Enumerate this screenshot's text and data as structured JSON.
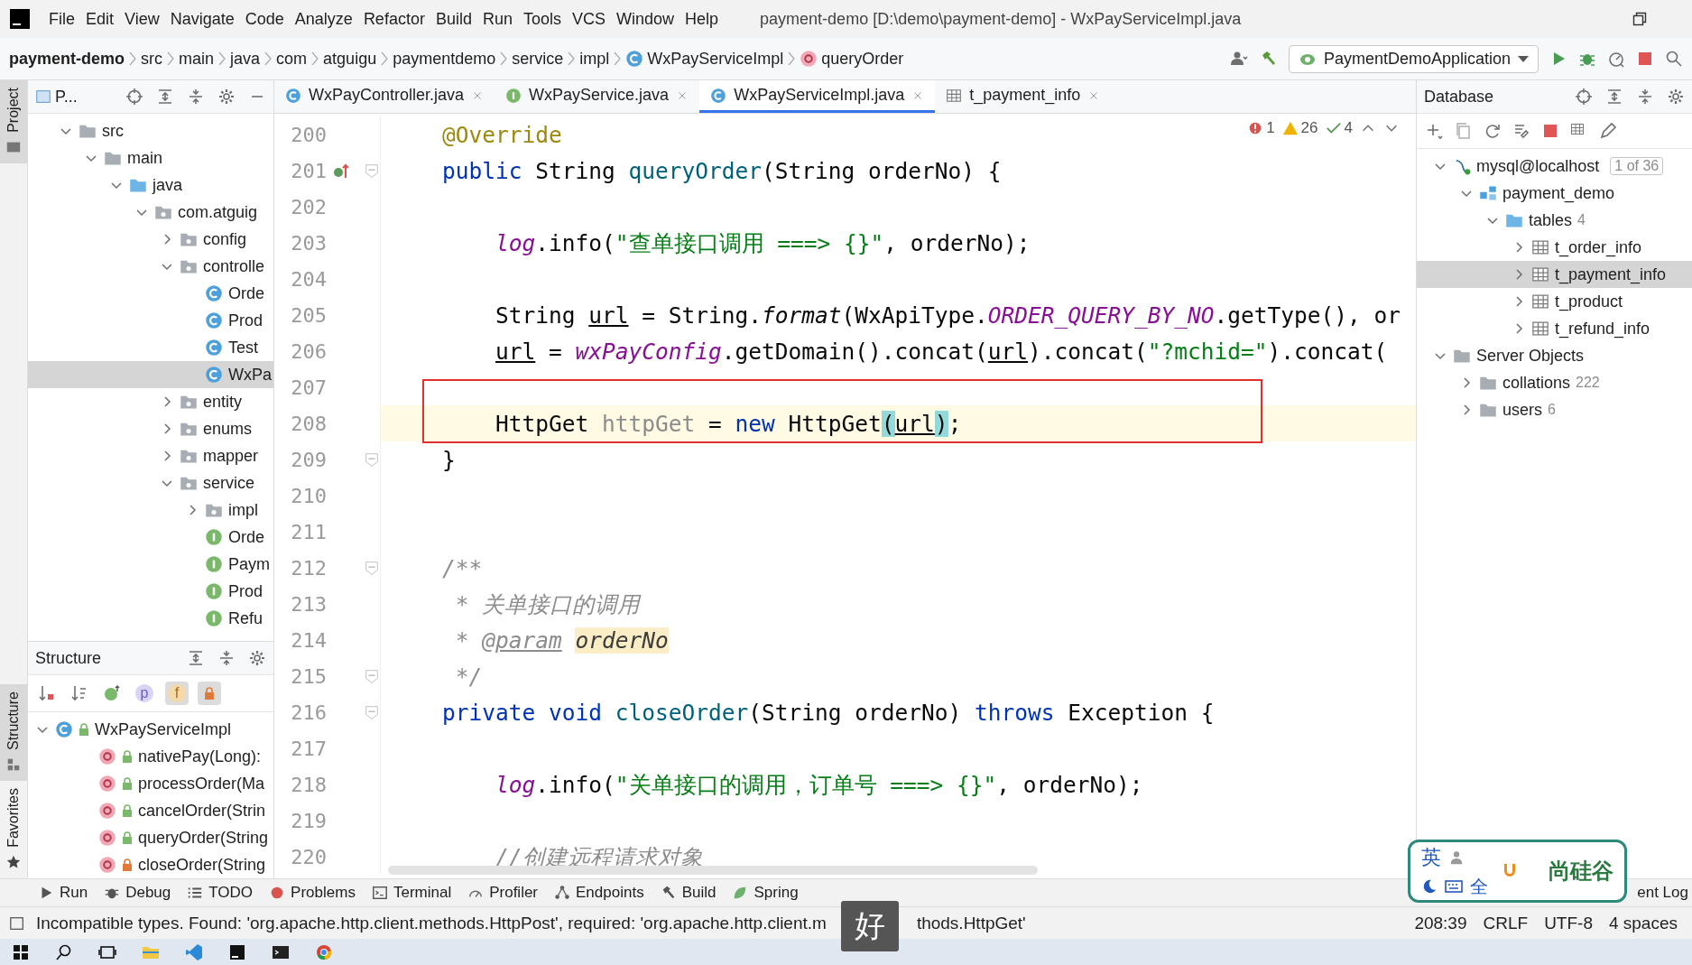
{
  "window": {
    "title": "payment-demo [D:\\demo\\payment-demo] - WxPayServiceImpl.java"
  },
  "menu": [
    "File",
    "Edit",
    "View",
    "Navigate",
    "Code",
    "Analyze",
    "Refactor",
    "Build",
    "Run",
    "Tools",
    "VCS",
    "Window",
    "Help"
  ],
  "breadcrumb": [
    {
      "label": "payment-demo",
      "kind": "project"
    },
    {
      "label": "src",
      "kind": "folder"
    },
    {
      "label": "main",
      "kind": "folder"
    },
    {
      "label": "java",
      "kind": "folder"
    },
    {
      "label": "com",
      "kind": "folder"
    },
    {
      "label": "atguigu",
      "kind": "folder"
    },
    {
      "label": "paymentdemo",
      "kind": "folder"
    },
    {
      "label": "service",
      "kind": "folder"
    },
    {
      "label": "impl",
      "kind": "folder"
    },
    {
      "label": "WxPayServiceImpl",
      "kind": "class"
    },
    {
      "label": "queryOrder",
      "kind": "method"
    }
  ],
  "run_config": {
    "label": "PaymentDemoApplication"
  },
  "tool_windows": [
    {
      "label": "Project",
      "kind": "project",
      "selected": true
    },
    {
      "label": "Structure",
      "kind": "structure",
      "selected": true
    },
    {
      "label": "Favorites",
      "kind": "favorites",
      "selected": false
    }
  ],
  "project": {
    "title": "P...",
    "tree": [
      {
        "label": "src",
        "kind": "folder",
        "expanded": true,
        "selected": false,
        "children": [
          {
            "label": "main",
            "kind": "folder",
            "expanded": true,
            "selected": false,
            "children": [
              {
                "label": "java",
                "kind": "source-folder",
                "expanded": true,
                "selected": false,
                "children": [
                  {
                    "label": "com.atguig",
                    "kind": "package",
                    "expanded": true,
                    "selected": false,
                    "children": [
                      {
                        "label": "config",
                        "kind": "package",
                        "expanded": false,
                        "selected": false
                      },
                      {
                        "label": "controlle",
                        "kind": "package",
                        "expanded": true,
                        "selected": false,
                        "children": [
                          {
                            "label": "Orde",
                            "kind": "class",
                            "selected": false
                          },
                          {
                            "label": "Prod",
                            "kind": "class",
                            "selected": false
                          },
                          {
                            "label": "Test",
                            "kind": "class",
                            "selected": false
                          },
                          {
                            "label": "WxPa",
                            "kind": "class",
                            "selected": true
                          }
                        ]
                      },
                      {
                        "label": "entity",
                        "kind": "package",
                        "expanded": false,
                        "selected": false
                      },
                      {
                        "label": "enums",
                        "kind": "package",
                        "expanded": false,
                        "selected": false
                      },
                      {
                        "label": "mapper",
                        "kind": "package",
                        "expanded": false,
                        "selected": false
                      },
                      {
                        "label": "service",
                        "kind": "package",
                        "expanded": true,
                        "selected": false,
                        "children": [
                          {
                            "label": "impl",
                            "kind": "package",
                            "expanded": false,
                            "selected": false
                          },
                          {
                            "label": "Orde",
                            "kind": "interface",
                            "selected": false
                          },
                          {
                            "label": "Paym",
                            "kind": "interface",
                            "selected": false
                          },
                          {
                            "label": "Prod",
                            "kind": "interface",
                            "selected": false
                          },
                          {
                            "label": "Refu",
                            "kind": "interface",
                            "selected": false
                          }
                        ]
                      }
                    ]
                  }
                ]
              }
            ]
          }
        ]
      }
    ]
  },
  "structure": {
    "title": "Structure",
    "filters": [
      {
        "kind": "sort-visibility",
        "selected": false
      },
      {
        "kind": "sort-alpha",
        "selected": false
      },
      {
        "kind": "inherited",
        "selected": false
      },
      {
        "kind": "properties",
        "glyph": "p",
        "selected": false
      },
      {
        "kind": "fields",
        "glyph": "f",
        "selected": true
      },
      {
        "kind": "non-public",
        "selected": true
      }
    ],
    "tree": [
      {
        "label": "WxPayServiceImpl",
        "kind": "class",
        "private": false,
        "expanded": true,
        "selected": false,
        "children": [
          {
            "label": "nativePay(Long):",
            "kind": "method",
            "private": false,
            "selected": false
          },
          {
            "label": "processOrder(Ma",
            "kind": "method",
            "private": false,
            "selected": false
          },
          {
            "label": "cancelOrder(Strin",
            "kind": "method",
            "private": false,
            "selected": false
          },
          {
            "label": "queryOrder(String",
            "kind": "method",
            "private": false,
            "selected": false
          },
          {
            "label": "closeOrder(String",
            "kind": "method",
            "private": true,
            "selected": false
          }
        ]
      }
    ]
  },
  "editor": {
    "tabs": [
      {
        "label": "WxPayController.java",
        "kind": "class",
        "selected": false
      },
      {
        "label": "WxPayService.java",
        "kind": "interface",
        "selected": false
      },
      {
        "label": "WxPayServiceImpl.java",
        "kind": "class",
        "selected": true
      },
      {
        "label": "t_payment_info",
        "kind": "table",
        "selected": false
      }
    ],
    "inspections": {
      "errors": "1",
      "warnings": "26",
      "weak_warnings": "4"
    },
    "lines": [
      {
        "number": "200",
        "fold": false,
        "marker": false,
        "current": false,
        "kind": "member",
        "tokens": [
          {
            "text": "@Override",
            "kind": "annotation"
          }
        ]
      },
      {
        "number": "201",
        "fold": true,
        "marker": true,
        "current": false,
        "kind": "member",
        "tokens": [
          {
            "text": "public",
            "kind": "keyword"
          },
          {
            "text": " String ",
            "kind": "plain"
          },
          {
            "text": "queryOrder",
            "kind": "declaration"
          },
          {
            "text": "(String orderNo) {",
            "kind": "plain"
          }
        ]
      },
      {
        "number": "202",
        "fold": false,
        "marker": false,
        "current": false
      },
      {
        "number": "203",
        "fold": false,
        "marker": false,
        "current": false,
        "kind": "statement",
        "tokens": [
          {
            "text": "log",
            "kind": "field"
          },
          {
            "text": ".info(",
            "kind": "plain"
          },
          {
            "text": "\"查单接口调用 ===> {}\"",
            "kind": "string"
          },
          {
            "text": ", orderNo);",
            "kind": "plain"
          }
        ]
      },
      {
        "number": "204",
        "fold": false,
        "marker": false,
        "current": false
      },
      {
        "number": "205",
        "fold": false,
        "marker": false,
        "current": false,
        "kind": "statement",
        "tokens": [
          {
            "text": "String ",
            "kind": "plain"
          },
          {
            "text": "url",
            "kind": "reassigned"
          },
          {
            "text": " = String.",
            "kind": "plain"
          },
          {
            "text": "format",
            "kind": "static"
          },
          {
            "text": "(WxApiType.",
            "kind": "plain"
          },
          {
            "text": "ORDER_QUERY_BY_NO",
            "kind": "constant"
          },
          {
            "text": ".getType(), or",
            "kind": "plain"
          }
        ]
      },
      {
        "number": "206",
        "fold": false,
        "marker": false,
        "current": false,
        "kind": "statement",
        "tokens": [
          {
            "text": "url",
            "kind": "reassigned"
          },
          {
            "text": " = ",
            "kind": "plain"
          },
          {
            "text": "wxPayConfig",
            "kind": "field"
          },
          {
            "text": ".getDomain().concat(",
            "kind": "plain"
          },
          {
            "text": "url",
            "kind": "reassigned"
          },
          {
            "text": ").concat(",
            "kind": "plain"
          },
          {
            "text": "\"?mchid=\"",
            "kind": "string"
          },
          {
            "text": ").concat(",
            "kind": "plain"
          }
        ]
      },
      {
        "number": "207",
        "fold": false,
        "marker": false,
        "current": false
      },
      {
        "number": "208",
        "fold": false,
        "marker": false,
        "current": true,
        "kind": "statement",
        "tokens": [
          {
            "text": "HttpGet ",
            "kind": "plain"
          },
          {
            "text": "httpGet",
            "kind": "unused"
          },
          {
            "text": " = ",
            "kind": "plain"
          },
          {
            "text": "new",
            "kind": "keyword"
          },
          {
            "text": " HttpGet",
            "kind": "plain"
          },
          {
            "text": "(",
            "kind": "brace"
          },
          {
            "text": "url",
            "kind": "reassigned"
          },
          {
            "text": ")",
            "kind": "brace"
          },
          {
            "text": ";",
            "kind": "plain"
          }
        ]
      },
      {
        "number": "209",
        "fold": true,
        "marker": false,
        "current": false,
        "kind": "member",
        "tokens": [
          {
            "text": "}",
            "kind": "plain"
          }
        ]
      },
      {
        "number": "210",
        "fold": false,
        "marker": false,
        "current": false
      },
      {
        "number": "211",
        "fold": false,
        "marker": false,
        "current": false
      },
      {
        "number": "212",
        "fold": true,
        "marker": false,
        "current": false,
        "kind": "member",
        "tokens": [
          {
            "text": "/**",
            "kind": "doc"
          }
        ]
      },
      {
        "number": "213",
        "fold": false,
        "marker": false,
        "current": false,
        "kind": "member",
        "tokens": [
          {
            "text": " * 关单接口的调用",
            "kind": "doc"
          }
        ]
      },
      {
        "number": "214",
        "fold": false,
        "marker": false,
        "current": false,
        "kind": "member",
        "tokens": [
          {
            "text": " * ",
            "kind": "doc"
          },
          {
            "text": "@param",
            "kind": "doc-tag"
          },
          {
            "text": "orderNo",
            "kind": "doc-param"
          }
        ]
      },
      {
        "number": "215",
        "fold": true,
        "marker": false,
        "current": false,
        "kind": "member",
        "tokens": [
          {
            "text": " */",
            "kind": "doc"
          }
        ]
      },
      {
        "number": "216",
        "fold": true,
        "marker": false,
        "current": false,
        "kind": "member",
        "tokens": [
          {
            "text": "private void",
            "kind": "keyword"
          },
          {
            "text": " closeOrder",
            "kind": "declaration"
          },
          {
            "text": "(String orderNo) ",
            "kind": "plain"
          },
          {
            "text": "throws",
            "kind": "keyword"
          },
          {
            "text": " Exception {",
            "kind": "plain"
          }
        ]
      },
      {
        "number": "217",
        "fold": false,
        "marker": false,
        "current": false
      },
      {
        "number": "218",
        "fold": false,
        "marker": false,
        "current": false,
        "kind": "statement",
        "tokens": [
          {
            "text": "log",
            "kind": "field"
          },
          {
            "text": ".info(",
            "kind": "plain"
          },
          {
            "text": "\"关单接口的调用，订单号 ===> {}\"",
            "kind": "string"
          },
          {
            "text": ", orderNo);",
            "kind": "plain"
          }
        ]
      },
      {
        "number": "219",
        "fold": false,
        "marker": false,
        "current": false
      },
      {
        "number": "220",
        "fold": false,
        "marker": false,
        "current": false,
        "kind": "statement",
        "tokens": [
          {
            "text": "//创建远程请求对象",
            "kind": "comment"
          }
        ]
      }
    ]
  },
  "database": {
    "title": "Database",
    "tree": [
      {
        "label": "mysql@localhost",
        "kind": "connection",
        "badge": "1 of 36",
        "expanded": true,
        "selected": false,
        "children": [
          {
            "label": "payment_demo",
            "kind": "schema",
            "expanded": true,
            "selected": false,
            "children": [
              {
                "label": "tables",
                "kind": "source-folder",
                "count": "4",
                "expanded": true,
                "selected": false,
                "children": [
                  {
                    "label": "t_order_info",
                    "kind": "table",
                    "expanded": false,
                    "selected": false
                  },
                  {
                    "label": "t_payment_info",
                    "kind": "table",
                    "expanded": false,
                    "selected": true
                  },
                  {
                    "label": "t_product",
                    "kind": "table",
                    "expanded": false,
                    "selected": false
                  },
                  {
                    "label": "t_refund_info",
                    "kind": "table",
                    "expanded": false,
                    "selected": false
                  }
                ]
              }
            ]
          }
        ]
      },
      {
        "label": "Server Objects",
        "kind": "folder",
        "expanded": true,
        "selected": false,
        "children": [
          {
            "label": "collations",
            "kind": "folder",
            "count": "222",
            "expanded": false,
            "selected": false
          },
          {
            "label": "users",
            "kind": "folder",
            "count": "6",
            "expanded": false,
            "selected": false
          }
        ]
      }
    ]
  },
  "bottom_tools": [
    {
      "label": "Run",
      "kind": "run"
    },
    {
      "label": "Debug",
      "kind": "debug"
    },
    {
      "label": "TODO",
      "kind": "todo"
    },
    {
      "label": "Problems",
      "kind": "problems"
    },
    {
      "label": "Terminal",
      "kind": "terminal"
    },
    {
      "label": "Profiler",
      "kind": "profiler"
    },
    {
      "label": "Endpoints",
      "kind": "endpoints"
    },
    {
      "label": "Build",
      "kind": "build"
    },
    {
      "label": "Spring",
      "kind": "spring"
    },
    {
      "label": "ent Log",
      "kind": "event-log"
    }
  ],
  "status": {
    "message_before": "Incompatible types. Found: 'org.apache.http.client.methods.HttpPost', required: 'org.apache.http.client.m",
    "message_after": "thods.HttpGet'",
    "position": "208:39",
    "line_separator": "CRLF",
    "encoding": "UTF-8",
    "indent": "4 spaces"
  },
  "subtitle": "好",
  "ime": {
    "mode": "英",
    "width": "全",
    "brand": "尚硅谷"
  },
  "taskbar": [
    {
      "kind": "start"
    },
    {
      "kind": "search"
    },
    {
      "kind": "task-view"
    },
    {
      "kind": "explorer"
    },
    {
      "kind": "vscode"
    },
    {
      "kind": "intellij"
    },
    {
      "kind": "terminal"
    },
    {
      "kind": "chrome"
    }
  ]
}
